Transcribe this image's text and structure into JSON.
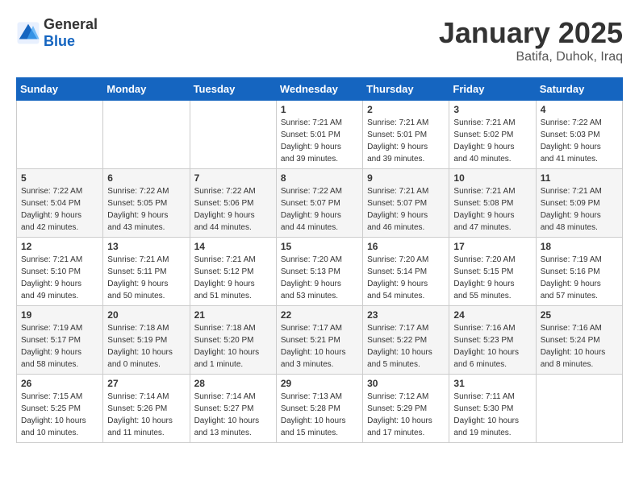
{
  "header": {
    "logo_general": "General",
    "logo_blue": "Blue",
    "month_title": "January 2025",
    "location": "Batifa, Duhok, Iraq"
  },
  "calendar": {
    "days_of_week": [
      "Sunday",
      "Monday",
      "Tuesday",
      "Wednesday",
      "Thursday",
      "Friday",
      "Saturday"
    ],
    "weeks": [
      [
        {
          "day": "",
          "info": ""
        },
        {
          "day": "",
          "info": ""
        },
        {
          "day": "",
          "info": ""
        },
        {
          "day": "1",
          "info": "Sunrise: 7:21 AM\nSunset: 5:01 PM\nDaylight: 9 hours\nand 39 minutes."
        },
        {
          "day": "2",
          "info": "Sunrise: 7:21 AM\nSunset: 5:01 PM\nDaylight: 9 hours\nand 39 minutes."
        },
        {
          "day": "3",
          "info": "Sunrise: 7:21 AM\nSunset: 5:02 PM\nDaylight: 9 hours\nand 40 minutes."
        },
        {
          "day": "4",
          "info": "Sunrise: 7:22 AM\nSunset: 5:03 PM\nDaylight: 9 hours\nand 41 minutes."
        }
      ],
      [
        {
          "day": "5",
          "info": "Sunrise: 7:22 AM\nSunset: 5:04 PM\nDaylight: 9 hours\nand 42 minutes."
        },
        {
          "day": "6",
          "info": "Sunrise: 7:22 AM\nSunset: 5:05 PM\nDaylight: 9 hours\nand 43 minutes."
        },
        {
          "day": "7",
          "info": "Sunrise: 7:22 AM\nSunset: 5:06 PM\nDaylight: 9 hours\nand 44 minutes."
        },
        {
          "day": "8",
          "info": "Sunrise: 7:22 AM\nSunset: 5:07 PM\nDaylight: 9 hours\nand 44 minutes."
        },
        {
          "day": "9",
          "info": "Sunrise: 7:21 AM\nSunset: 5:07 PM\nDaylight: 9 hours\nand 46 minutes."
        },
        {
          "day": "10",
          "info": "Sunrise: 7:21 AM\nSunset: 5:08 PM\nDaylight: 9 hours\nand 47 minutes."
        },
        {
          "day": "11",
          "info": "Sunrise: 7:21 AM\nSunset: 5:09 PM\nDaylight: 9 hours\nand 48 minutes."
        }
      ],
      [
        {
          "day": "12",
          "info": "Sunrise: 7:21 AM\nSunset: 5:10 PM\nDaylight: 9 hours\nand 49 minutes."
        },
        {
          "day": "13",
          "info": "Sunrise: 7:21 AM\nSunset: 5:11 PM\nDaylight: 9 hours\nand 50 minutes."
        },
        {
          "day": "14",
          "info": "Sunrise: 7:21 AM\nSunset: 5:12 PM\nDaylight: 9 hours\nand 51 minutes."
        },
        {
          "day": "15",
          "info": "Sunrise: 7:20 AM\nSunset: 5:13 PM\nDaylight: 9 hours\nand 53 minutes."
        },
        {
          "day": "16",
          "info": "Sunrise: 7:20 AM\nSunset: 5:14 PM\nDaylight: 9 hours\nand 54 minutes."
        },
        {
          "day": "17",
          "info": "Sunrise: 7:20 AM\nSunset: 5:15 PM\nDaylight: 9 hours\nand 55 minutes."
        },
        {
          "day": "18",
          "info": "Sunrise: 7:19 AM\nSunset: 5:16 PM\nDaylight: 9 hours\nand 57 minutes."
        }
      ],
      [
        {
          "day": "19",
          "info": "Sunrise: 7:19 AM\nSunset: 5:17 PM\nDaylight: 9 hours\nand 58 minutes."
        },
        {
          "day": "20",
          "info": "Sunrise: 7:18 AM\nSunset: 5:19 PM\nDaylight: 10 hours\nand 0 minutes."
        },
        {
          "day": "21",
          "info": "Sunrise: 7:18 AM\nSunset: 5:20 PM\nDaylight: 10 hours\nand 1 minute."
        },
        {
          "day": "22",
          "info": "Sunrise: 7:17 AM\nSunset: 5:21 PM\nDaylight: 10 hours\nand 3 minutes."
        },
        {
          "day": "23",
          "info": "Sunrise: 7:17 AM\nSunset: 5:22 PM\nDaylight: 10 hours\nand 5 minutes."
        },
        {
          "day": "24",
          "info": "Sunrise: 7:16 AM\nSunset: 5:23 PM\nDaylight: 10 hours\nand 6 minutes."
        },
        {
          "day": "25",
          "info": "Sunrise: 7:16 AM\nSunset: 5:24 PM\nDaylight: 10 hours\nand 8 minutes."
        }
      ],
      [
        {
          "day": "26",
          "info": "Sunrise: 7:15 AM\nSunset: 5:25 PM\nDaylight: 10 hours\nand 10 minutes."
        },
        {
          "day": "27",
          "info": "Sunrise: 7:14 AM\nSunset: 5:26 PM\nDaylight: 10 hours\nand 11 minutes."
        },
        {
          "day": "28",
          "info": "Sunrise: 7:14 AM\nSunset: 5:27 PM\nDaylight: 10 hours\nand 13 minutes."
        },
        {
          "day": "29",
          "info": "Sunrise: 7:13 AM\nSunset: 5:28 PM\nDaylight: 10 hours\nand 15 minutes."
        },
        {
          "day": "30",
          "info": "Sunrise: 7:12 AM\nSunset: 5:29 PM\nDaylight: 10 hours\nand 17 minutes."
        },
        {
          "day": "31",
          "info": "Sunrise: 7:11 AM\nSunset: 5:30 PM\nDaylight: 10 hours\nand 19 minutes."
        },
        {
          "day": "",
          "info": ""
        }
      ]
    ]
  }
}
